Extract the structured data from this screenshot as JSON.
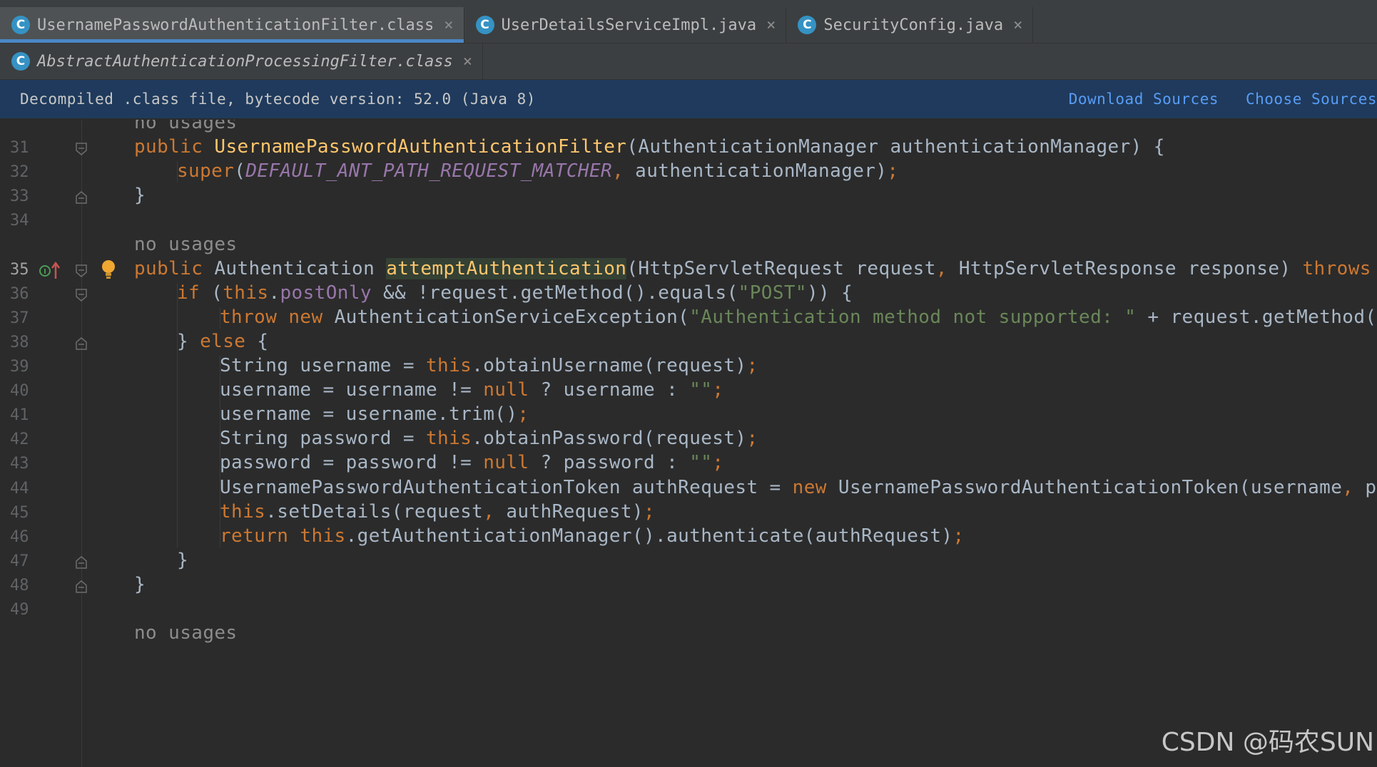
{
  "tabs_row1": [
    {
      "label": "UsernamePasswordAuthenticationFilter.class",
      "icon": "C",
      "active": true
    },
    {
      "label": "UserDetailsServiceImpl.java",
      "icon": "C",
      "active": false
    },
    {
      "label": "SecurityConfig.java",
      "icon": "C",
      "active": false
    }
  ],
  "tabs_row2": [
    {
      "label": "AbstractAuthenticationProcessingFilter.class",
      "icon": "C",
      "active": false
    }
  ],
  "banner": {
    "text": "Decompiled .class file, bytecode version: 52.0 (Java 8)",
    "download_sources": "Download Sources",
    "choose_sources": "Choose Sources"
  },
  "code_lines": [
    {
      "num": "",
      "text": "no usages"
    },
    {
      "num": "31",
      "text": "public UsernamePasswordAuthenticationFilter(AuthenticationManager authenticationManager) {"
    },
    {
      "num": "32",
      "text": "super(DEFAULT_ANT_PATH_REQUEST_MATCHER, authenticationManager);"
    },
    {
      "num": "33",
      "text": "}"
    },
    {
      "num": "34",
      "text": ""
    },
    {
      "num": "",
      "text": "no usages"
    },
    {
      "num": "35",
      "text": "public Authentication attemptAuthentication(HttpServletRequest request, HttpServletResponse response) throws Authent"
    },
    {
      "num": "36",
      "text": "if (this.postOnly && !request.getMethod().equals(\"POST\")) {"
    },
    {
      "num": "37",
      "text": "throw new AuthenticationServiceException(\"Authentication method not supported: \" + request.getMethod());"
    },
    {
      "num": "38",
      "text": "} else {"
    },
    {
      "num": "39",
      "text": "String username = this.obtainUsername(request);"
    },
    {
      "num": "40",
      "text": "username = username != null ? username : \"\";"
    },
    {
      "num": "41",
      "text": "username = username.trim();"
    },
    {
      "num": "42",
      "text": "String password = this.obtainPassword(request);"
    },
    {
      "num": "43",
      "text": "password = password != null ? password : \"\";"
    },
    {
      "num": "44",
      "text": "UsernamePasswordAuthenticationToken authRequest = new UsernamePasswordAuthenticationToken(username, password"
    },
    {
      "num": "45",
      "text": "this.setDetails(request, authRequest);"
    },
    {
      "num": "46",
      "text": "return this.getAuthenticationManager().authenticate(authRequest);"
    },
    {
      "num": "47",
      "text": "}"
    },
    {
      "num": "48",
      "text": "}"
    },
    {
      "num": "49",
      "text": ""
    },
    {
      "num": "",
      "text": "no usages"
    }
  ],
  "watermark": "CSDN @码农SUN",
  "colors": {
    "background": "#2b2b2b",
    "keyword": "#cc7832",
    "method": "#ffc66d",
    "field": "#9876aa",
    "string": "#6a8759",
    "link": "#589df6",
    "banner": "#1f3a5c"
  }
}
